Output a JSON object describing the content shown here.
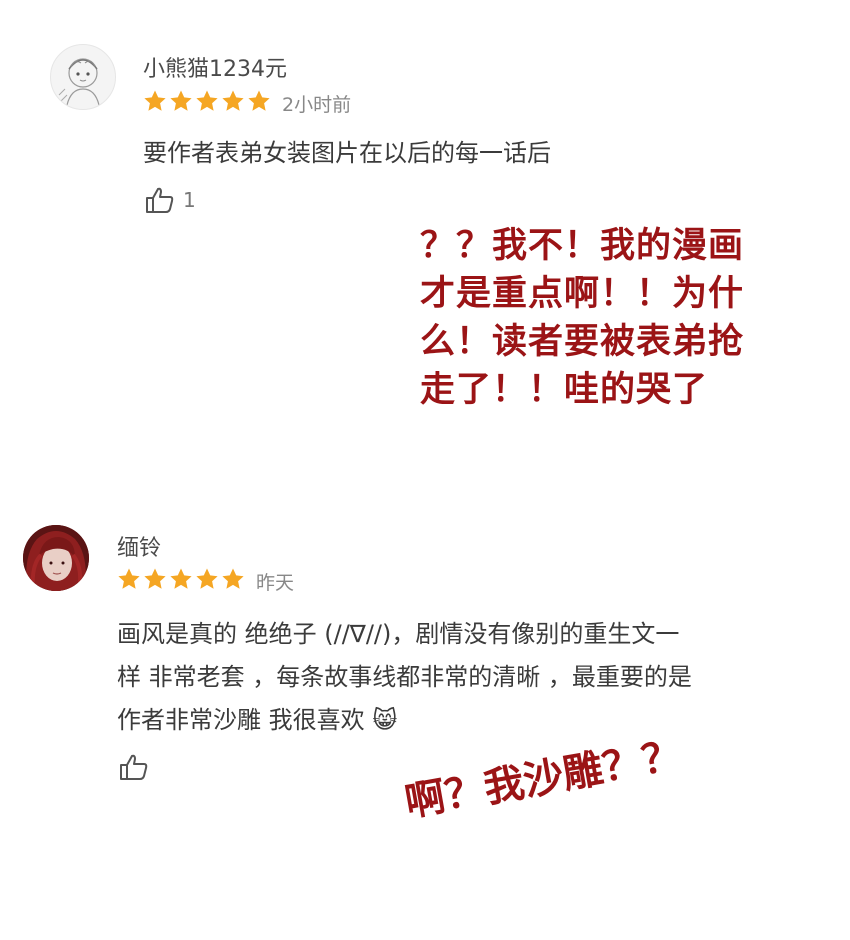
{
  "comments": [
    {
      "username": "小熊猫1234元",
      "rating": 5,
      "time": "2小时前",
      "text": "要作者表弟女装图片在以后的每一话后",
      "likes": "1"
    },
    {
      "username": "缅铃",
      "rating": 5,
      "time": "昨天",
      "text_lines": [
        "画风是真的 绝绝子 (//∇//)，剧情没有像别的重生文一",
        "样 非常老套 ，每条故事线都非常的清晰 ，最重要的是",
        "作者非常沙雕 我很喜欢 😸"
      ],
      "likes": ""
    }
  ],
  "annotations": {
    "first_lines": [
      "？？我不！我的漫画",
      "才是重点啊！！为什",
      "么！读者要被表弟抢",
      "走了！！哇的哭了"
    ],
    "second": "啊？我沙雕？？"
  },
  "colors": {
    "star": "#f5a623",
    "annotation": "#9b1416"
  }
}
